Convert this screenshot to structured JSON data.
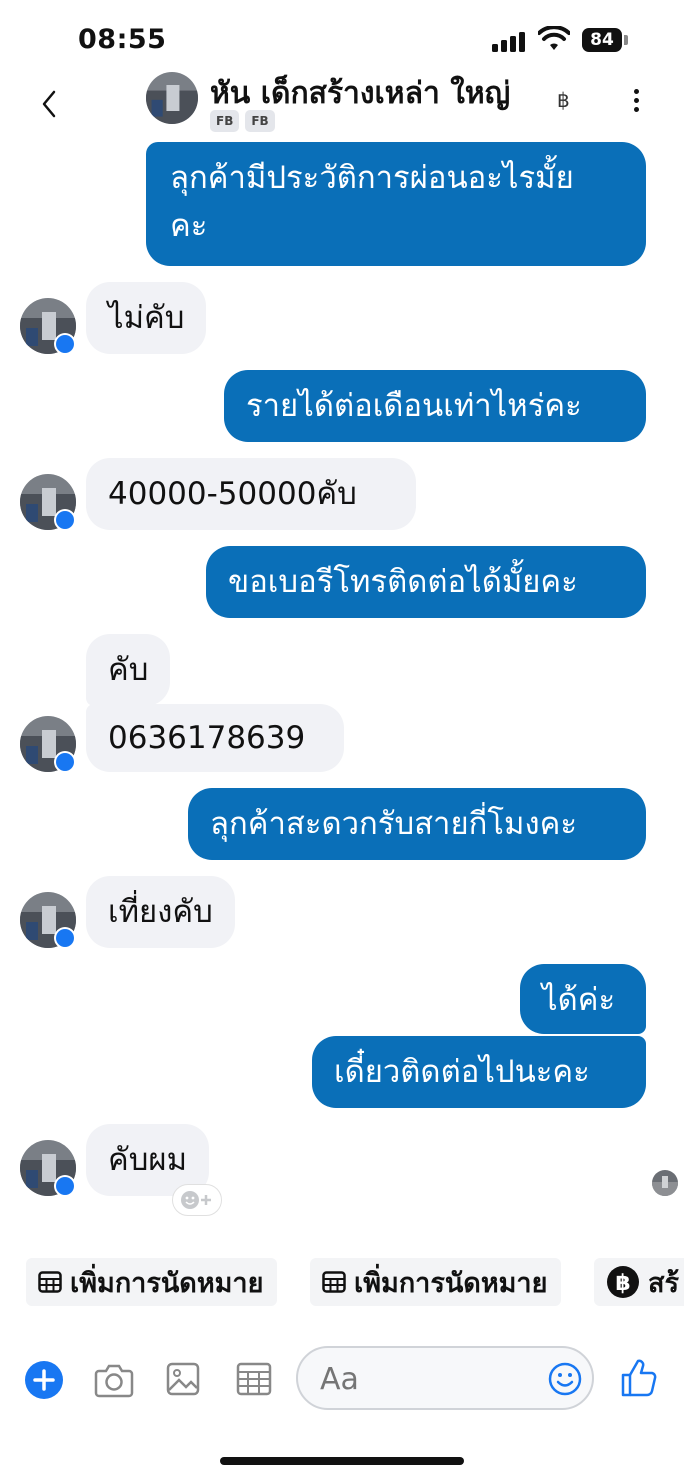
{
  "status_bar": {
    "time": "08:55",
    "battery": "84"
  },
  "header": {
    "name": "หัน เด็กสร้างเหล่า ใหญ่",
    "currency_symbol": "฿",
    "tags": [
      "FB",
      "FB"
    ]
  },
  "messages": [
    {
      "direction": "out",
      "text": "ลุกค้ามีประวัติการผ่อนอะไรมั้ย",
      "text2": "คะ"
    },
    {
      "direction": "in",
      "text": "ไม่คับ"
    },
    {
      "direction": "out",
      "text": "รายได้ต่อเดือนเท่าไหร่คะ"
    },
    {
      "direction": "in",
      "text": "40000-50000คับ"
    },
    {
      "direction": "out",
      "text": "ขอเบอรีโทรติดต่อได้มั้ยคะ"
    },
    {
      "direction": "in",
      "text": "คับ"
    },
    {
      "direction": "in",
      "text": "0636178639"
    },
    {
      "direction": "out",
      "text": "ลุกค้าสะดวกรับสายกี่โมงคะ"
    },
    {
      "direction": "in",
      "text": "เที่ยงคับ"
    },
    {
      "direction": "out",
      "text": "ได้ค่ะ"
    },
    {
      "direction": "out",
      "text": "เดี๋ยวติดต่อไปนะคะ"
    },
    {
      "direction": "in",
      "text": "คับผม"
    }
  ],
  "quick_actions": [
    {
      "icon": "calendar-icon",
      "label": "เพิ่มการนัดหมาย"
    },
    {
      "icon": "calendar-icon",
      "label": "เพิ่มการนัดหมาย"
    },
    {
      "icon": "baht-icon",
      "label": "สร้"
    }
  ],
  "composer": {
    "placeholder": "Aa"
  },
  "colors": {
    "outgoing": "#0a6fb8",
    "incoming": "#f1f2f6",
    "accent": "#1877f2"
  }
}
